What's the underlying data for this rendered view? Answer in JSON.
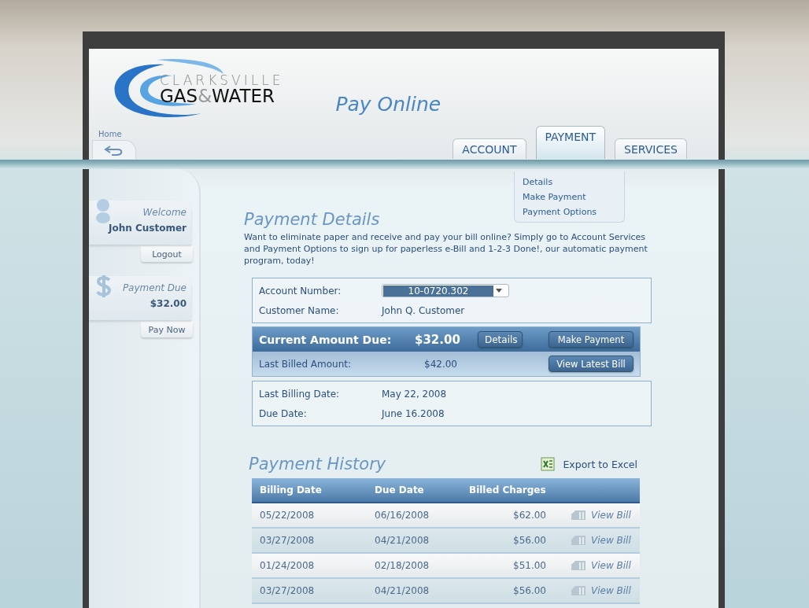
{
  "header": {
    "logo": {
      "top": "CLARKSVILLE",
      "left": "GAS",
      "ampersand": "&",
      "right": "WATER"
    },
    "title": "Pay Online",
    "home": "Home"
  },
  "tabs": [
    {
      "label": "ACCOUNT",
      "selected": false
    },
    {
      "label": "PAYMENT",
      "selected": true
    },
    {
      "label": "SERVICES",
      "selected": false
    }
  ],
  "submenu": [
    "Details",
    "Make Payment",
    "Payment Options"
  ],
  "sidebar": {
    "welcome": {
      "label": "Welcome",
      "name": "John Customer",
      "button": "Logout"
    },
    "payment_due": {
      "label": "Payment Due",
      "amount": "$32.00",
      "button": "Pay Now"
    }
  },
  "details": {
    "title": "Payment Details",
    "intro": "Want to eliminate paper and receive and pay your bill online?  Simply go to Account Services and Payment Options to sign up for paperless e-Bill and 1-2-3 Done!, our automatic payment program, today!",
    "account_label": "Account Number:",
    "account_value": "10-0720.302",
    "customer_label": "Customer Name:",
    "customer_value": "John Q. Customer",
    "current_label": "Current Amount Due:",
    "current_value": "$32.00",
    "details_button": "Details",
    "pay_button": "Make Payment",
    "last_label": "Last Billed Amount:",
    "last_value": "$42.00",
    "view_button": "View Latest Bill",
    "billing_date_label": "Last Billing Date:",
    "billing_date_value": "May 22, 2008",
    "due_date_label": "Due Date:",
    "due_date_value": "June 16.2008"
  },
  "history": {
    "title": "Payment History",
    "export": "Export to Excel",
    "columns": [
      "Billing Date",
      "Due Date",
      "Billed Charges"
    ],
    "rows": [
      {
        "billing_date": "05/22/2008",
        "due_date": "06/16/2008",
        "charges": "$62.00",
        "link": "View Bill"
      },
      {
        "billing_date": "03/27/2008",
        "due_date": "04/21/2008",
        "charges": "$56.00",
        "link": "View Bill"
      },
      {
        "billing_date": "01/24/2008",
        "due_date": "02/18/2008",
        "charges": "$51.00",
        "link": "View Bill"
      },
      {
        "billing_date": "03/27/2008",
        "due_date": "04/21/2008",
        "charges": "$56.00",
        "link": "View Bill"
      }
    ]
  }
}
